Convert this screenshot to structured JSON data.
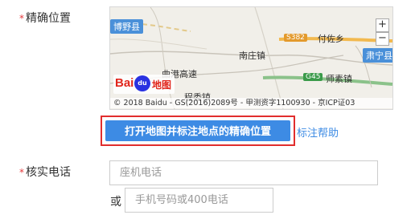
{
  "location": {
    "required_mark": "*",
    "label": "精确位置"
  },
  "map": {
    "towns": {
      "boye": "博野县",
      "fuxiang": "付佐乡",
      "nanzhuang": "南庄镇",
      "quganggaosu": "曲港高速",
      "shisu": "师素镇",
      "suning": "肃宁县",
      "chengdu": "程委镇"
    },
    "roads": {
      "s382": "S382",
      "g45": "G45"
    },
    "zoom_in": "+",
    "zoom_out": "−",
    "logo_text": "Bai",
    "logo_paw": "du",
    "logo_cn": "地图",
    "copyright": "© 2018 Baidu - GS(2016)2089号 - 甲测资字1100930 - 京ICP证03"
  },
  "button": {
    "label": "打开地图并标注地点的精确位置"
  },
  "help_link": "标注帮助",
  "phone": {
    "required_mark": "*",
    "label": "核实电话",
    "landline_placeholder": "座机电话",
    "or_label": "或",
    "mobile_placeholder": "手机号码或400电话"
  },
  "colors": {
    "accent": "#3d8be4",
    "highlight_border": "#e12d2d",
    "required": "#e4393c"
  }
}
